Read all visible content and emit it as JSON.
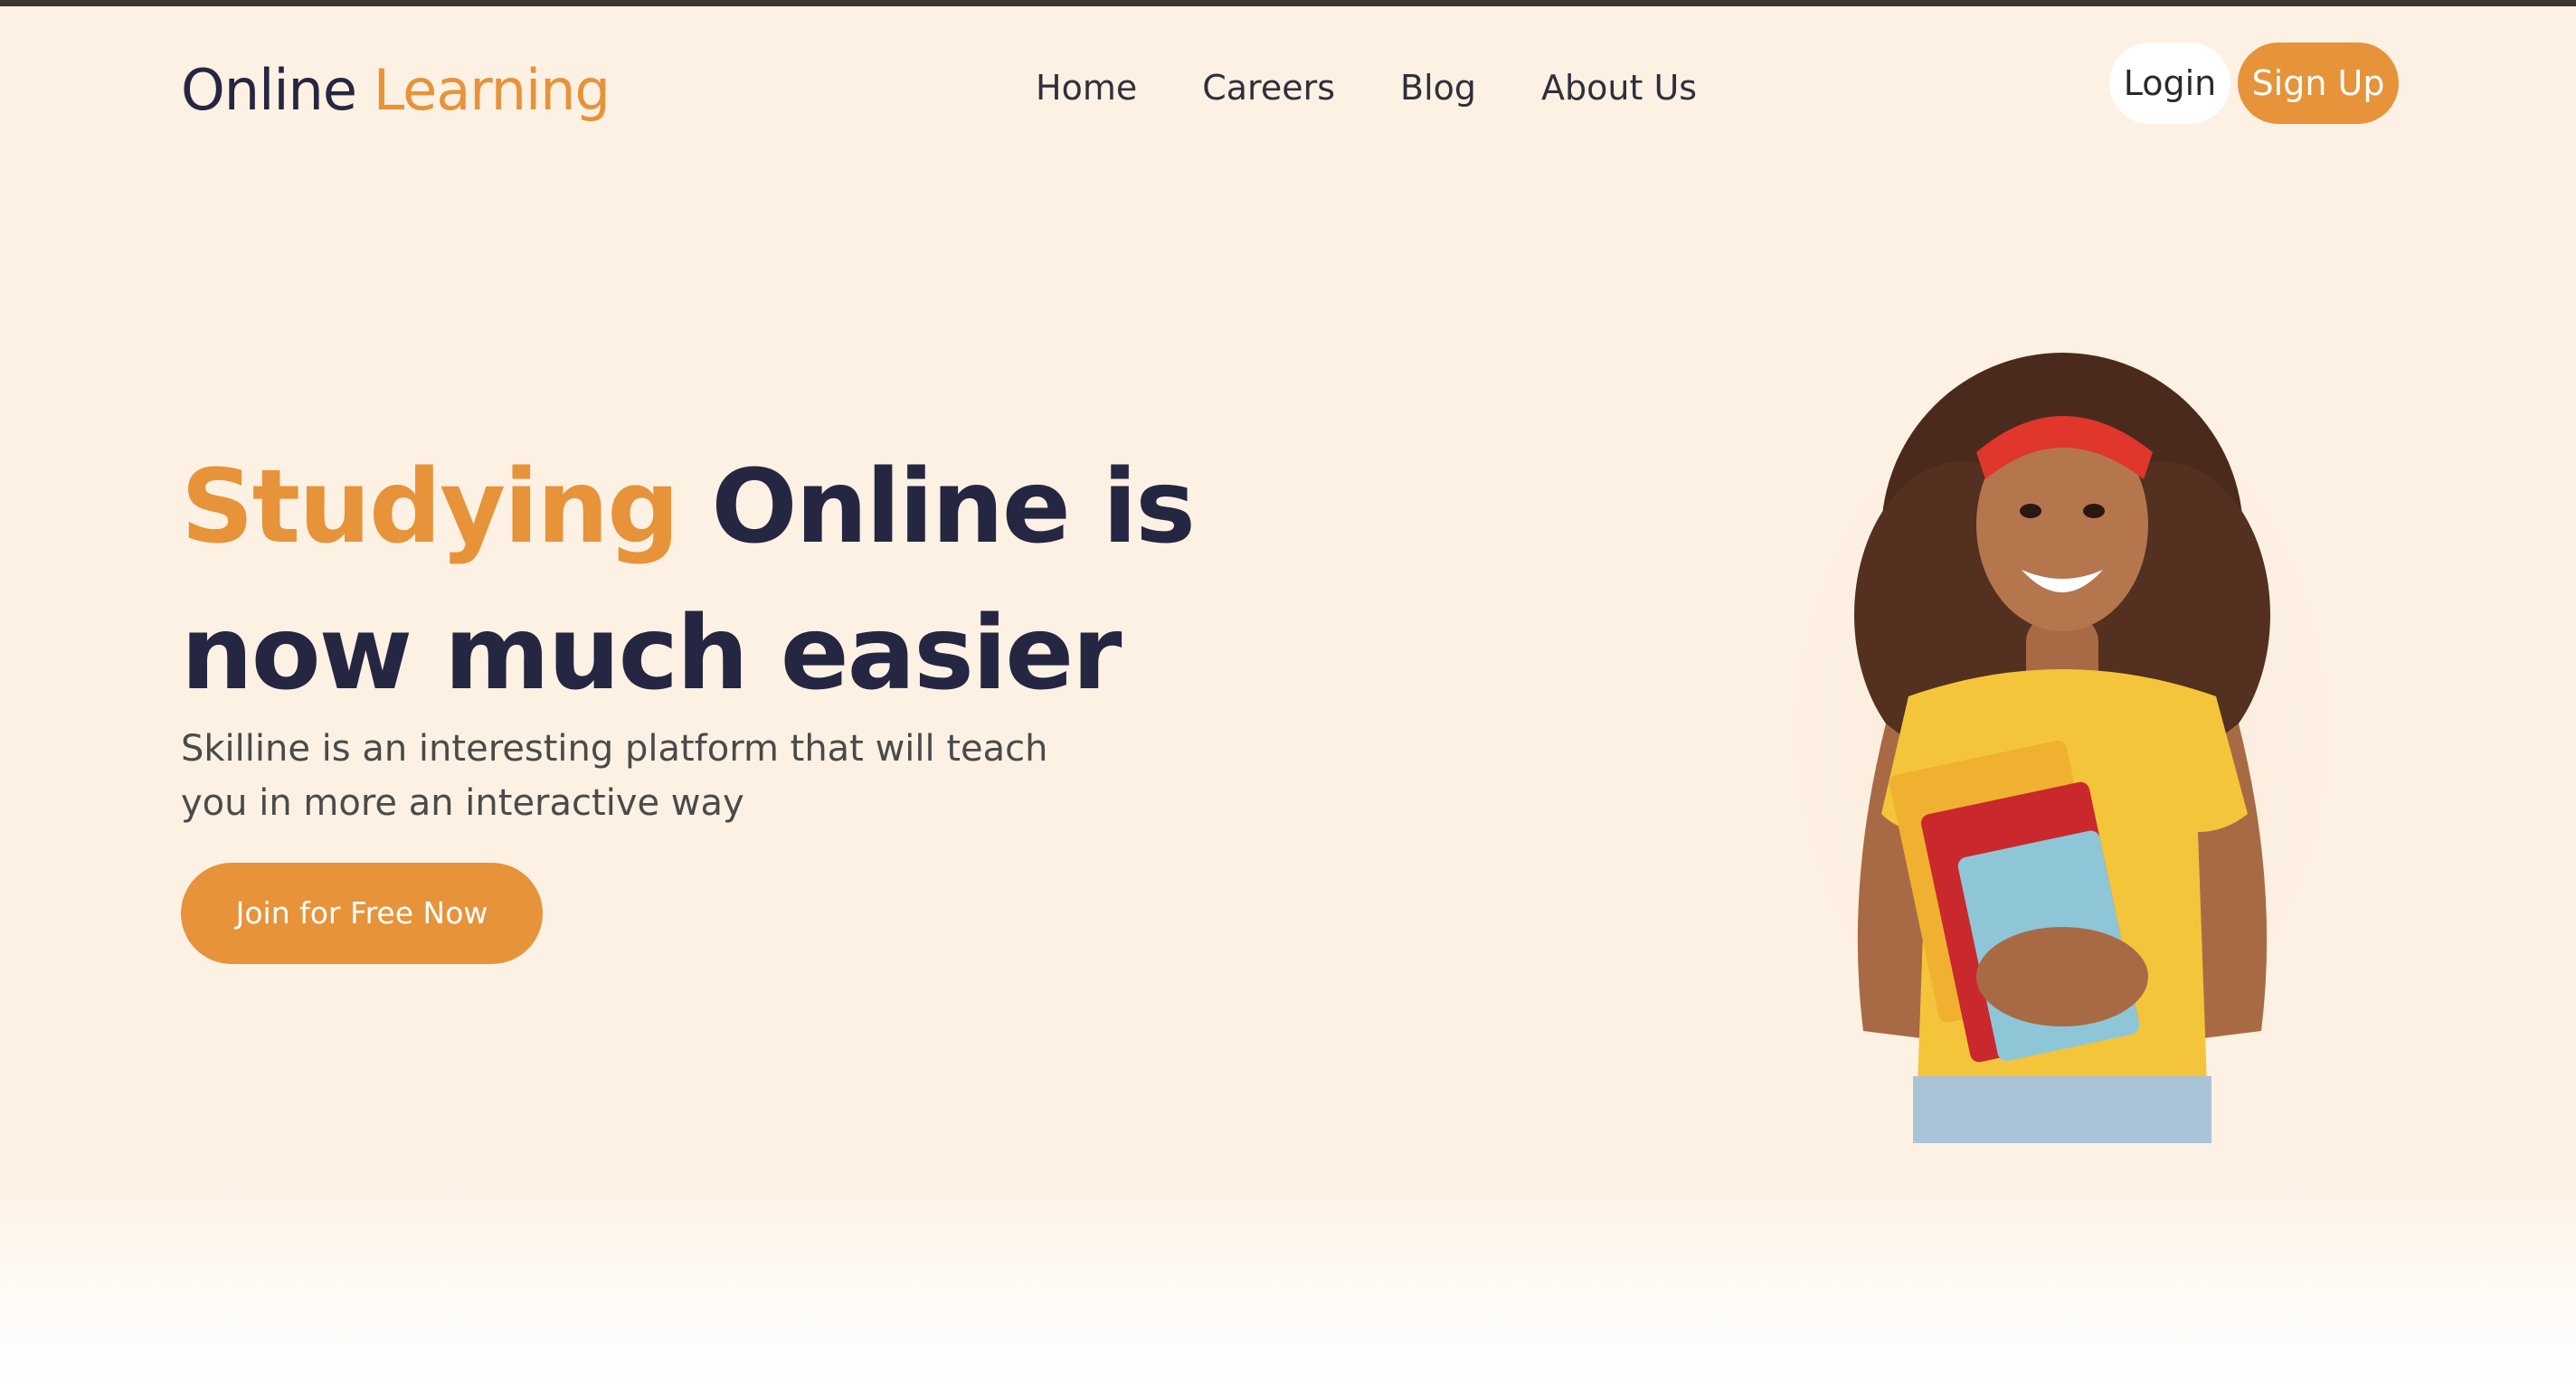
{
  "header": {
    "logo": {
      "part1": "Online",
      "part2": "Learning"
    },
    "nav": [
      {
        "label": "Home"
      },
      {
        "label": "Careers"
      },
      {
        "label": "Blog"
      },
      {
        "label": "About Us"
      }
    ],
    "login_label": "Login",
    "signup_label": "Sign Up"
  },
  "hero": {
    "title_highlight": "Studying",
    "title_rest": " Online is now much easier",
    "subtitle": "Skilline is an interesting platform that will teach you in more an interactive way",
    "cta_label": "Join for Free Now"
  },
  "colors": {
    "background": "#fdf1e4",
    "accent": "#e6933a",
    "text_dark": "#252641"
  }
}
